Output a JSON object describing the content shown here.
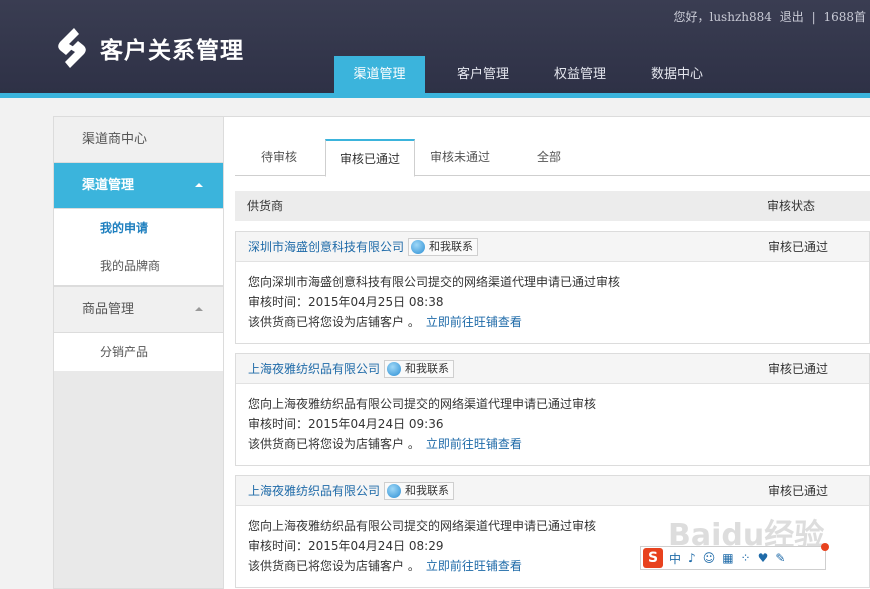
{
  "header": {
    "app_title": "客户关系管理",
    "greeting": "您好，lushzh884",
    "logout": "退出",
    "sep": "|",
    "site": "1688首"
  },
  "nav": {
    "items": [
      {
        "label": "渠道管理",
        "active": true
      },
      {
        "label": "客户管理"
      },
      {
        "label": "权益管理"
      },
      {
        "label": "数据中心"
      }
    ]
  },
  "sidebar": {
    "channel_center": "渠道商中心",
    "channel_mgmt": "渠道管理",
    "my_apply": "我的申请",
    "my_brand": "我的品牌商",
    "product_mgmt": "商品管理",
    "dist_products": "分销产品"
  },
  "tabs": [
    "待审核",
    "审核已通过",
    "审核未通过",
    "全部"
  ],
  "table": {
    "col_supplier": "供货商",
    "col_status": "审核状态"
  },
  "records": [
    {
      "supplier": "深圳市海盛创意科技有限公司",
      "contact": "和我联系",
      "status": "审核已通过",
      "message": "您向深圳市海盛创意科技有限公司提交的网络渠道代理申请已通过审核",
      "time": "审核时间：2015年04月25日 08:38",
      "note": "该供货商已将您设为店铺客户 。",
      "link": "立即前往旺铺查看"
    },
    {
      "supplier": "上海夜雅纺织品有限公司",
      "contact": "和我联系",
      "status": "审核已通过",
      "message": "您向上海夜雅纺织品有限公司提交的网络渠道代理申请已通过审核",
      "time": "审核时间：2015年04月24日 09:36",
      "note": "该供货商已将您设为店铺客户 。",
      "link": "立即前往旺铺查看"
    },
    {
      "supplier": "上海夜雅纺织品有限公司",
      "contact": "和我联系",
      "status": "审核已通过",
      "message": "您向上海夜雅纺织品有限公司提交的网络渠道代理申请已通过审核",
      "time": "审核时间：2015年04月24日 08:29",
      "note": "该供货商已将您设为店铺客户 。",
      "link": "立即前往旺铺查看"
    }
  ],
  "ime": {
    "zh": "中"
  },
  "watermark": "Baidu经验",
  "colors": {
    "accent": "#3bb4dc",
    "header_bg": "#33364b",
    "link": "#1e6aa8"
  }
}
